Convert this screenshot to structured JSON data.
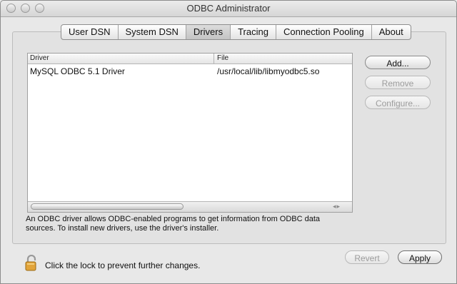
{
  "window": {
    "title": "ODBC Administrator"
  },
  "tabs": [
    {
      "label": "User DSN",
      "active": false
    },
    {
      "label": "System DSN",
      "active": false
    },
    {
      "label": "Drivers",
      "active": true
    },
    {
      "label": "Tracing",
      "active": false
    },
    {
      "label": "Connection Pooling",
      "active": false
    },
    {
      "label": "About",
      "active": false
    }
  ],
  "table": {
    "columns": [
      "Driver",
      "File"
    ],
    "rows": [
      [
        "MySQL ODBC 5.1 Driver",
        "/usr/local/lib/libmyodbc5.so"
      ]
    ]
  },
  "buttons": {
    "add": "Add...",
    "remove": "Remove",
    "configure": "Configure...",
    "revert": "Revert",
    "apply": "Apply"
  },
  "help_text": "An ODBC driver allows ODBC-enabled programs to get information from ODBC data sources. To install new drivers, use the driver's installer.",
  "lock": {
    "text": "Click the lock to prevent further changes.",
    "icon": "open-padlock-icon"
  }
}
